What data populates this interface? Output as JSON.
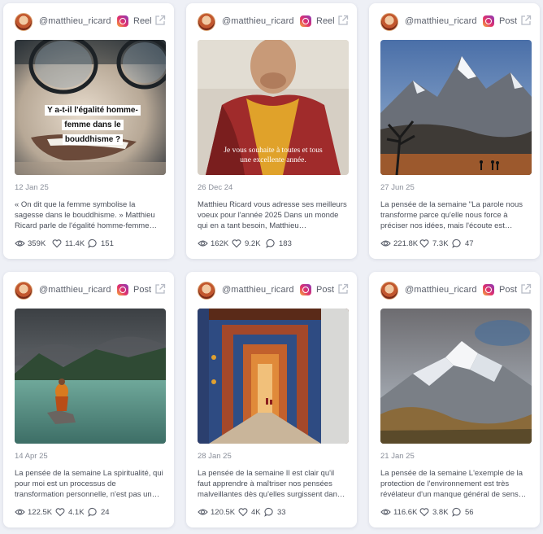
{
  "posts": [
    {
      "username": "@matthieu_ricard",
      "type": "Reel",
      "media_text": "Y a-t-il l'égalité homme-femme dans le bouddhisme ?",
      "date": "12 Jan 25",
      "caption": "« On dit que la femme symbolise la sagesse dans le bouddhisme. » Matthieu Ricard parle de l'égalité homme-femme…",
      "views": "359K",
      "likes": "11.4K",
      "comments": "151"
    },
    {
      "username": "@matthieu_ricard",
      "type": "Reel",
      "media_text": "Je vous souhaite à toutes et tous une excellente année.",
      "date": "26 Dec 24",
      "caption": "Matthieu Ricard vous adresse ses meilleurs voeux pour l'année 2025 Dans un monde qui en a tant besoin, Matthieu…",
      "views": "162K",
      "likes": "9.2K",
      "comments": "183"
    },
    {
      "username": "@matthieu_ricard",
      "type": "Post",
      "date": "27 Jun 25",
      "caption": "La pensée de la semaine \"La parole nous transforme parce qu'elle nous force à préciser nos idées, mais l'écoute est…",
      "views": "221.8K",
      "likes": "7.3K",
      "comments": "47"
    },
    {
      "username": "@matthieu_ricard",
      "type": "Post",
      "date": "14 Apr 25",
      "caption": "La pensée de la semaine La spiritualité, qui pour moi est un processus de transformation personnelle, n'est pas un…",
      "views": "122.5K",
      "likes": "4.1K",
      "comments": "24"
    },
    {
      "username": "@matthieu_ricard",
      "type": "Post",
      "date": "28 Jan 25",
      "caption": "La pensée de la semaine Il est clair qu'il faut apprendre à maîtriser nos pensées malveillantes dès qu'elles surgissent dan…",
      "views": "120.5K",
      "likes": "4K",
      "comments": "33"
    },
    {
      "username": "@matthieu_ricard",
      "type": "Post",
      "date": "21 Jan 25",
      "caption": "La pensée de la semaine L'exemple de la protection de l'environnement est très révélateur d'un manque général de sens…",
      "views": "116.6K",
      "likes": "3.8K",
      "comments": "56"
    }
  ],
  "icons": {
    "platform": "instagram-icon",
    "external": "external-link-icon",
    "views": "eye-icon",
    "likes": "heart-icon",
    "comments": "comment-icon"
  },
  "colors": {
    "background": "#eef0f6",
    "card": "#ffffff",
    "text": "#4a4f5a",
    "muted": "#8a8f9a"
  }
}
